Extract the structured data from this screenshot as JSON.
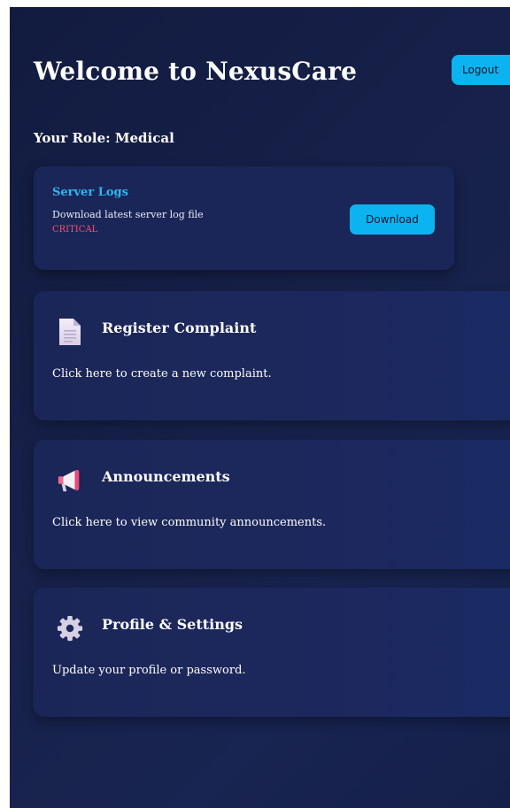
{
  "header": {
    "title": "Welcome to NexusCare",
    "logout_label": "Logout"
  },
  "role_text": "Your Role: Medical",
  "log_card": {
    "title": "Server Logs",
    "description": "Download latest server log file",
    "severity": "CRITICAL",
    "download_label": "Download"
  },
  "cards": [
    {
      "icon": "document-icon",
      "title": "Register Complaint",
      "description": "Click here to create a new complaint."
    },
    {
      "icon": "megaphone-icon",
      "title": "Announcements",
      "description": "Click here to view community announcements."
    },
    {
      "icon": "gear-icon",
      "title": "Profile & Settings",
      "description": "Update your profile or password."
    }
  ],
  "colors": {
    "accent": "#0bb4f0",
    "link": "#2cb6f2",
    "critical": "#ff4d6a"
  }
}
